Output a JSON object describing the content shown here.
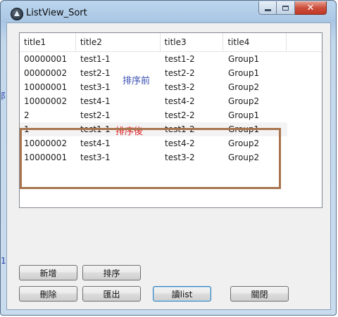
{
  "window": {
    "title": "ListView_Sort",
    "close_symbol": "✕"
  },
  "listview": {
    "columns": [
      "title1",
      "title2",
      "title3",
      "title4"
    ],
    "rows": [
      [
        "00000001",
        "test1-1",
        "test1-2",
        "Group1"
      ],
      [
        "00000002",
        "test2-1",
        "test2-2",
        "Group1"
      ],
      [
        "10000001",
        "test3-1",
        "test3-2",
        "Group2"
      ],
      [
        "10000002",
        "test4-1",
        "test4-2",
        "Group2"
      ],
      [
        "2",
        "test2-1",
        "test2-2",
        "Group1"
      ],
      [
        "1",
        "test1-1",
        "test1-2",
        "Group1"
      ],
      [
        "10000002",
        "test4-1",
        "test4-2",
        "Group2"
      ],
      [
        "10000001",
        "test3-1",
        "test3-2",
        "Group2"
      ]
    ]
  },
  "annotations": {
    "before_sort": "排序前",
    "after_sort": "排序後",
    "highlight_color": "#a8744d"
  },
  "buttons": {
    "add": "新增",
    "sort": "排序",
    "delete": "刪除",
    "export": "匯出",
    "read_list": "讀list",
    "close": "關閉"
  },
  "side_markers": {
    "top": "阝",
    "bottom": "1"
  }
}
